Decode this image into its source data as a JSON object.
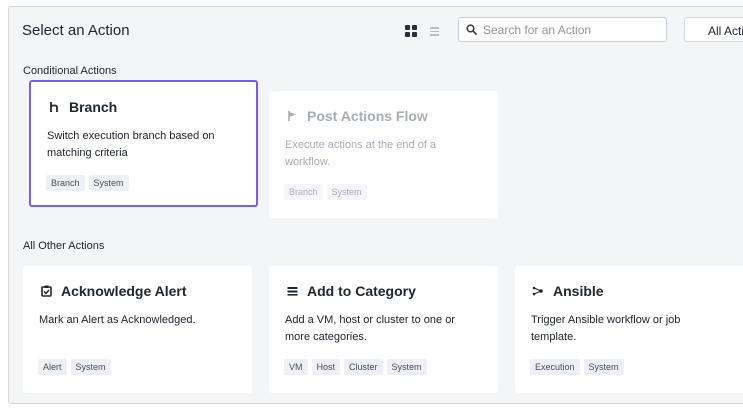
{
  "header": {
    "title": "Select an Action",
    "search_placeholder": "Search for an Action",
    "filter_label": "All Actions"
  },
  "sections": {
    "conditional": {
      "label": "Conditional Actions",
      "cards": [
        {
          "name": "Branch",
          "icon": "branch-icon",
          "description": "Switch execution branch based on matching criteria",
          "tags": [
            "Branch",
            "System"
          ],
          "selected": true,
          "disabled": false
        },
        {
          "name": "Post Actions Flow",
          "icon": "flag-icon",
          "description": "Execute actions at the end of a workflow.",
          "tags": [
            "Branch",
            "System"
          ],
          "selected": false,
          "disabled": true
        }
      ]
    },
    "other": {
      "label": "All Other Actions",
      "cards": [
        {
          "name": "Acknowledge Alert",
          "icon": "clipboard-check-icon",
          "description": "Mark an Alert as Acknowledged.",
          "tags": [
            "Alert",
            "System"
          ]
        },
        {
          "name": "Add to Category",
          "icon": "list-icon",
          "description": "Add a VM, host or cluster to one or more categories.",
          "tags": [
            "VM",
            "Host",
            "Cluster",
            "System"
          ]
        },
        {
          "name": "Ansible",
          "icon": "ansible-icon",
          "description": "Trigger Ansible workflow or job template.",
          "tags": [
            "Execution",
            "System"
          ]
        }
      ]
    }
  },
  "colors": {
    "selected_border": "#7b5cf0",
    "background": "#f4f5f7"
  }
}
